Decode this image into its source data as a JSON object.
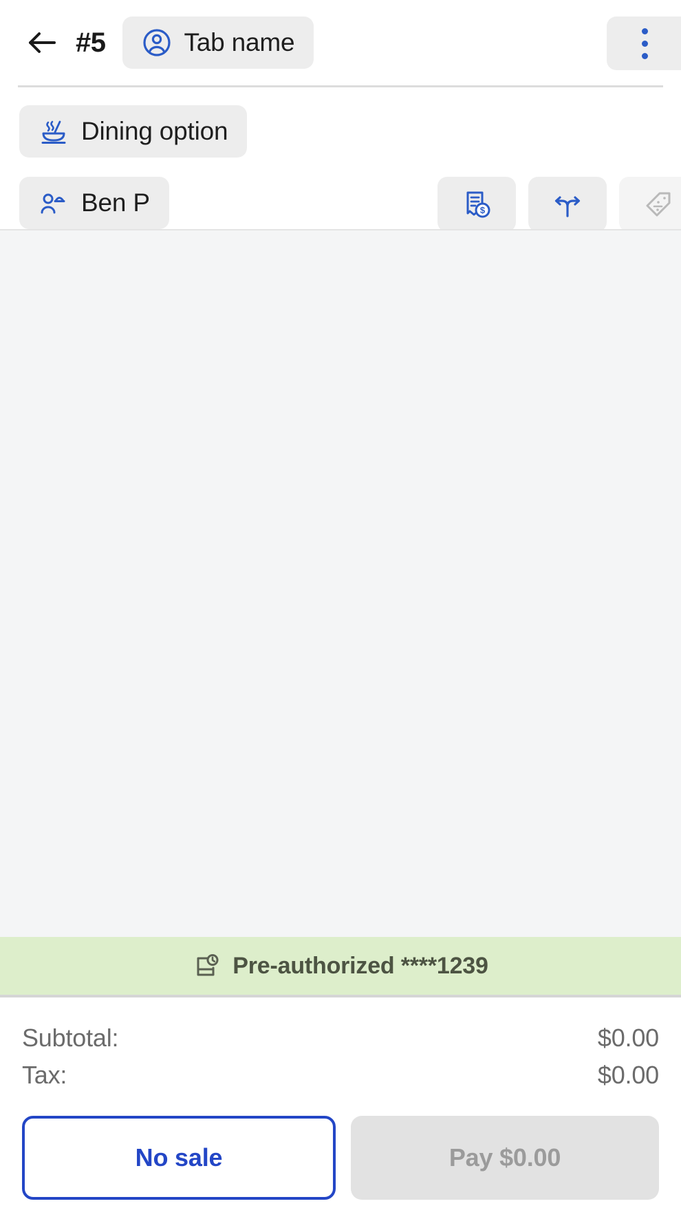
{
  "header": {
    "back_icon": "arrow-left-icon",
    "order_number": "#5",
    "tab_chip": {
      "icon": "account-circle-icon",
      "label": "Tab name"
    },
    "menu_icon": "more-vertical-icon"
  },
  "chips": {
    "dining_option": {
      "icon": "dining-bowl-icon",
      "label": "Dining option"
    },
    "server": {
      "icon": "room-service-person-icon",
      "label": "Ben P"
    }
  },
  "actions": [
    {
      "icon": "receipt-dollar-icon",
      "name": "receipt-dollar-button",
      "disabled": false
    },
    {
      "icon": "split-arrows-icon",
      "name": "split-order-button",
      "disabled": false
    },
    {
      "icon": "discount-tag-icon",
      "name": "discount-button",
      "disabled": true
    }
  ],
  "cart": {
    "items": []
  },
  "preauth": {
    "icon": "card-clock-icon",
    "text": "Pre-authorized ****1239"
  },
  "totals": [
    {
      "label": "Subtotal:",
      "value": "$0.00"
    },
    {
      "label": "Tax:",
      "value": "$0.00"
    }
  ],
  "footer": {
    "no_sale_label": "No sale",
    "pay_label": "Pay $0.00"
  },
  "colors": {
    "accent_blue": "#2b5cc7",
    "button_blue": "#2346c6",
    "chip_bg": "#ededed",
    "cart_bg": "#f4f5f6",
    "preauth_bg": "#ddeecb",
    "preauth_text": "#4d5443",
    "disabled_bg": "#e2e2e2",
    "disabled_text": "#9b9b9b",
    "muted_text": "#6b6b6b"
  }
}
